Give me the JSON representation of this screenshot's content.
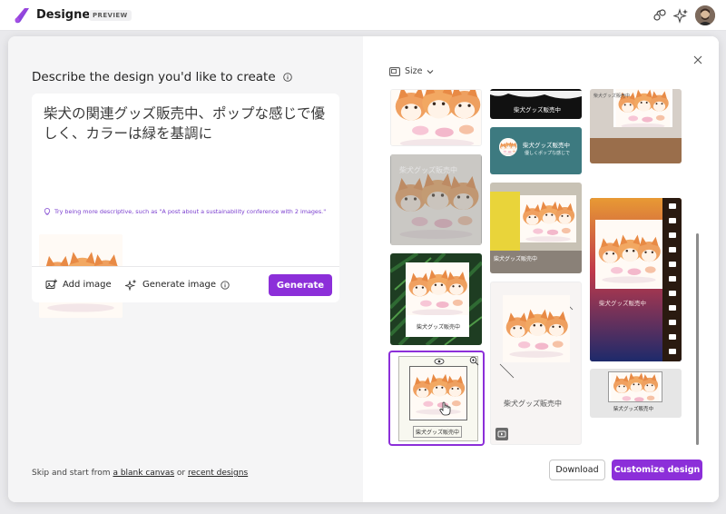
{
  "app": {
    "title": "Designer",
    "badge": "PREVIEW",
    "accent": "#8c2fd9"
  },
  "prompt": {
    "heading": "Describe the design you'd like to create",
    "text": "柴犬の関連グッズ販売中、ポップな感じで優しく、カラーは緑を基調に",
    "hint": "Try being more descriptive, such as \"A post about a sustainability conference with 2 images.\"",
    "add_image": "Add image",
    "generate_image": "Generate image",
    "generate": "Generate"
  },
  "footer": {
    "skip_prefix": "Skip and start from",
    "blank_canvas": "a blank canvas",
    "or": "or",
    "recent_designs": "recent designs"
  },
  "right": {
    "size_label": "Size",
    "download": "Download",
    "customize": "Customize design"
  },
  "designs": {
    "d2_title": "柴犬グッズ販売中",
    "d3_title": "柴犬グッズ販売中",
    "d3_sub": "優しくポップな感じで",
    "d4_title": "柴犬グッズ販売中",
    "d6_title": "柴犬グッズ販売中",
    "d7_title": "柴犬グッズ販売中",
    "d8_title": "柴犬グッズ販売中",
    "d9_title": "柴犬グッズ販売中",
    "d10_title": "柴犬グッズ販売中",
    "d11_title": "柴犬グッズ販売中"
  }
}
